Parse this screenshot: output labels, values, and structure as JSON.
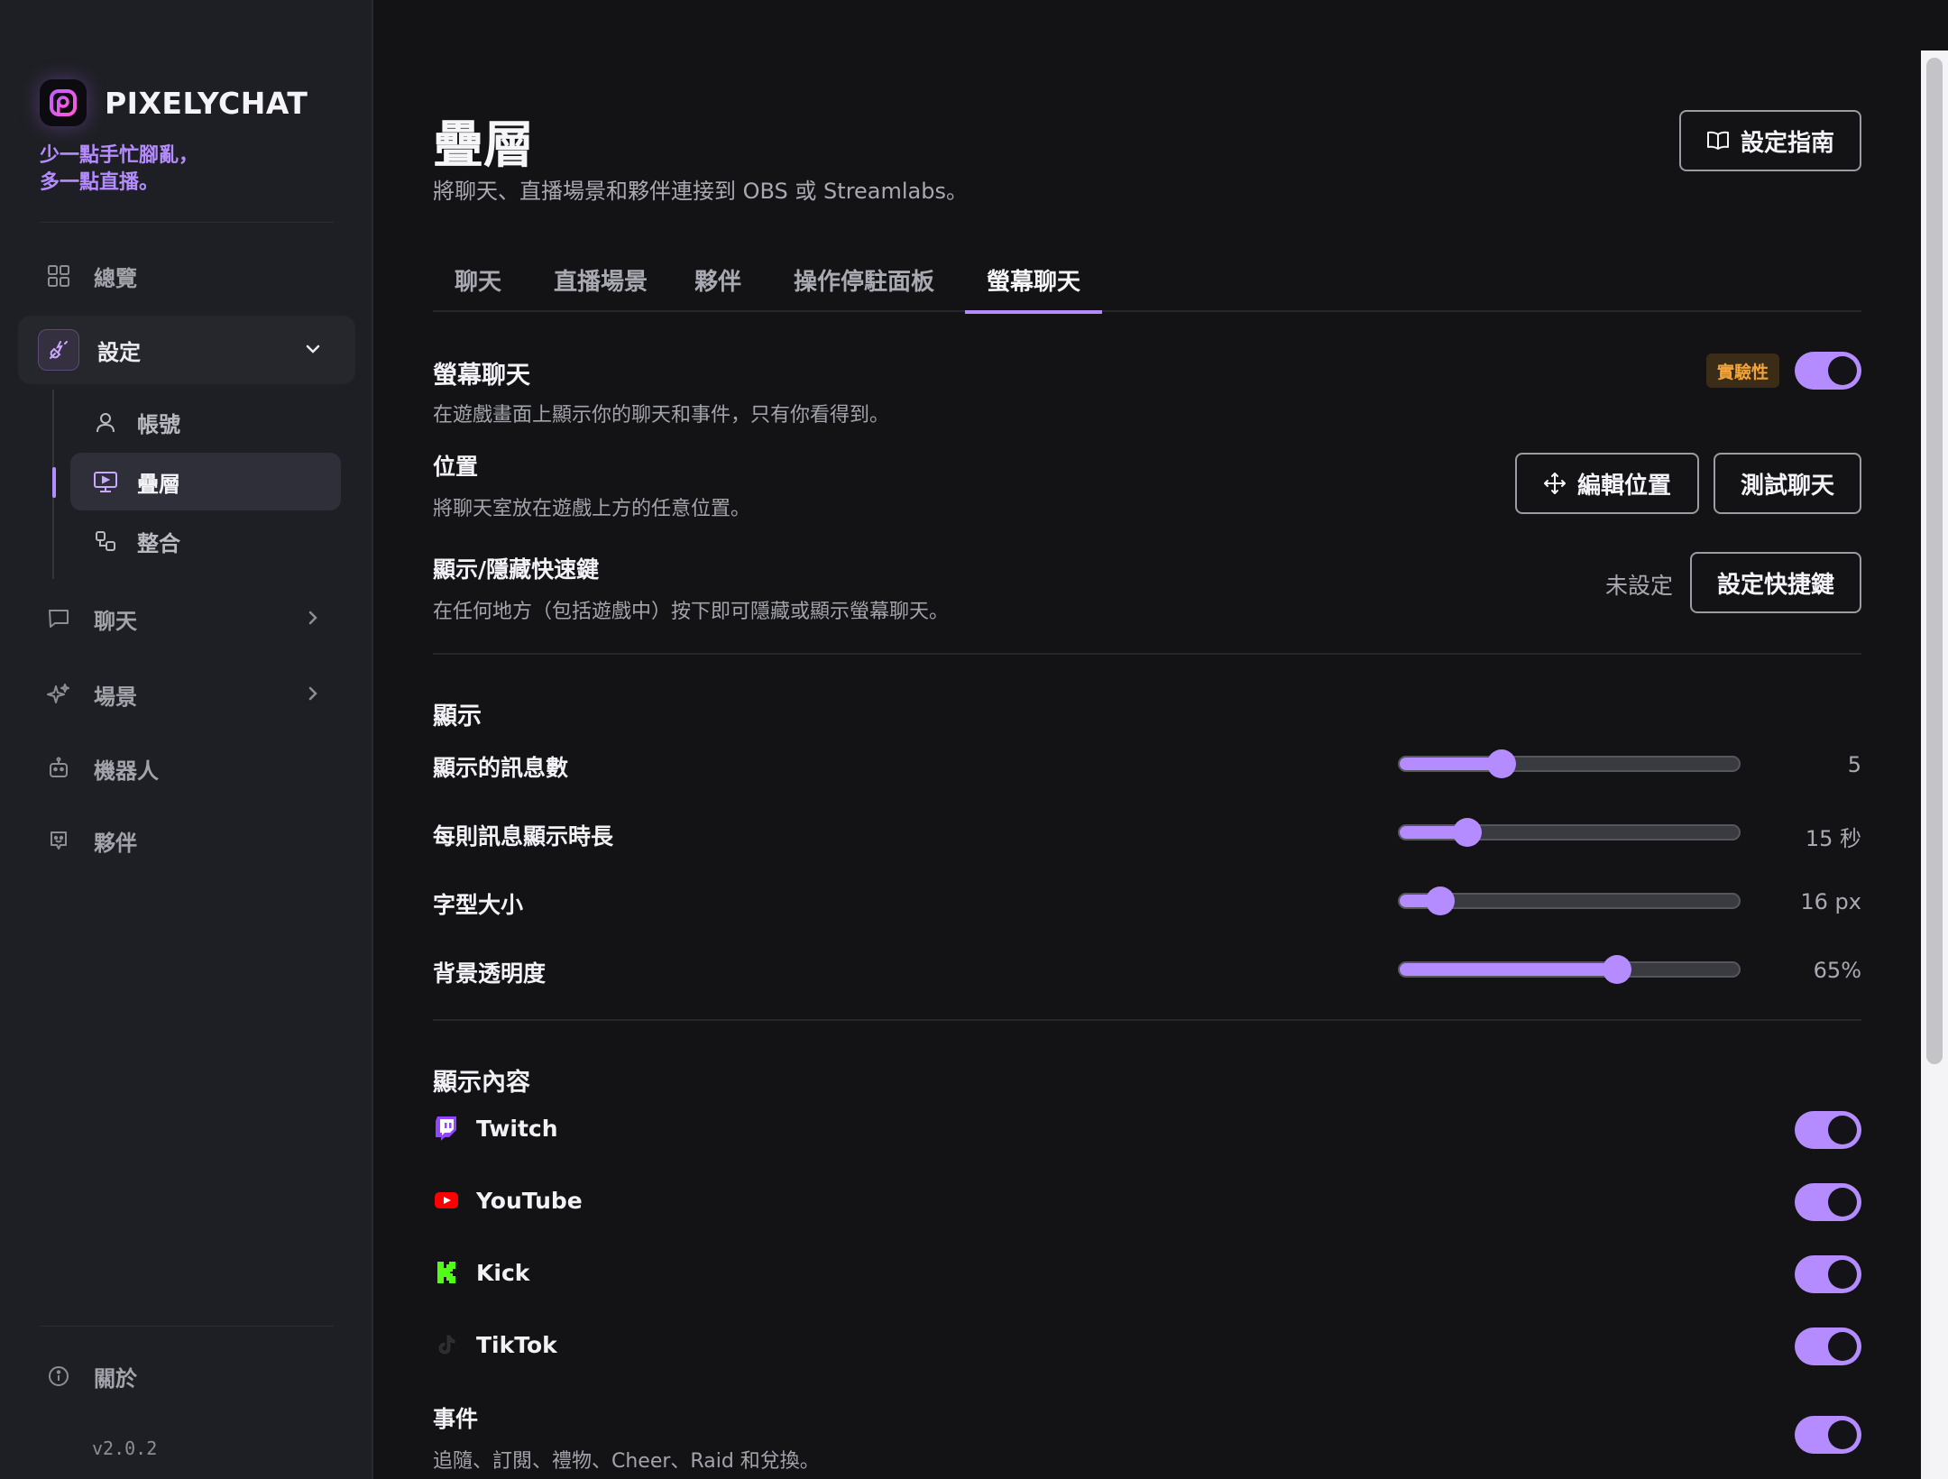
{
  "brand": {
    "name": "PIXELYCHAT",
    "tagline_line1": "少一點手忙腳亂，",
    "tagline_line2": "多一點直播。"
  },
  "sidebar": {
    "overview": "總覽",
    "settings": "設定",
    "sub": {
      "account": "帳號",
      "overlay": "疊層",
      "integrations": "整合"
    },
    "chat": "聊天",
    "scenes": "場景",
    "bots": "機器人",
    "partners": "夥伴",
    "about": "關於",
    "version": "v2.0.2"
  },
  "page": {
    "title": "疊層",
    "subtitle": "將聊天、直播場景和夥伴連接到 OBS 或 Streamlabs。",
    "guide_button": "設定指南"
  },
  "tabs": [
    "聊天",
    "直播場景",
    "夥伴",
    "操作停駐面板",
    "螢幕聊天"
  ],
  "screen_chat": {
    "title": "螢幕聊天",
    "desc": "在遊戲畫面上顯示你的聊天和事件，只有你看得到。",
    "badge": "實驗性",
    "enabled": true,
    "position_title": "位置",
    "position_desc": "將聊天室放在遊戲上方的任意位置。",
    "edit_position_button": "編輯位置",
    "test_chat_button": "測試聊天",
    "hotkey_title": "顯示/隱藏快速鍵",
    "hotkey_desc": "在任何地方（包括遊戲中）按下即可隱藏或顯示螢幕聊天。",
    "hotkey_value": "未設定",
    "hotkey_button": "設定快捷鍵"
  },
  "display": {
    "title": "顯示",
    "sliders": [
      {
        "label": "顯示的訊息數",
        "value_text": "5",
        "fraction": 0.3
      },
      {
        "label": "每則訊息顯示時長",
        "value_text": "15 秒",
        "fraction": 0.2
      },
      {
        "label": "字型大小",
        "value_text": "16 px",
        "fraction": 0.12
      },
      {
        "label": "背景透明度",
        "value_text": "65%",
        "fraction": 0.64
      }
    ]
  },
  "content": {
    "title": "顯示內容",
    "platforms": [
      {
        "name": "Twitch",
        "icon": "twitch-icon",
        "color": "#9146ff",
        "enabled": true
      },
      {
        "name": "YouTube",
        "icon": "youtube-icon",
        "color": "#ff0000",
        "enabled": true
      },
      {
        "name": "Kick",
        "icon": "kick-icon",
        "color": "#53fc18",
        "enabled": true
      },
      {
        "name": "TikTok",
        "icon": "tiktok-icon",
        "color": "#111111",
        "enabled": true
      }
    ],
    "events_title": "事件",
    "events_desc": "追隨、訂閱、禮物、Cheer、Raid 和兌換。",
    "events_enabled": true
  },
  "colors": {
    "accent": "#b58cff",
    "badge_text": "#f2a33a",
    "background": "#131316",
    "sidebar": "#1e1f24"
  }
}
